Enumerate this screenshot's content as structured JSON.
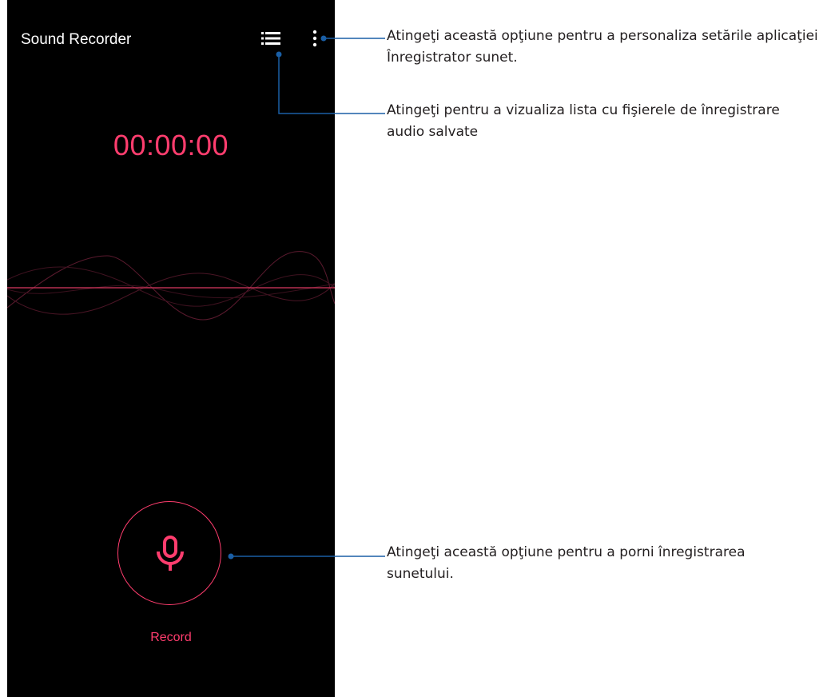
{
  "app": {
    "title": "Sound Recorder",
    "accent_color": "#ff3d6e",
    "background_color": "#000000"
  },
  "toolbar": {
    "list_icon": "list-icon",
    "more_icon": "more-vert-icon"
  },
  "timer": {
    "value": "00:00:00"
  },
  "record": {
    "icon": "microphone-icon",
    "label": "Record"
  },
  "annotations": {
    "callout_color": "#1a5fa6",
    "settings_note": "Atingeţi această opţiune pentru a personaliza setările aplicaţiei Înregistrator sunet.",
    "list_note": "Atingeţi pentru a vizualiza lista cu fişierele de înregistrare audio salvate",
    "record_note": "Atingeţi această opţiune pentru a porni înregistrarea sunetului."
  }
}
